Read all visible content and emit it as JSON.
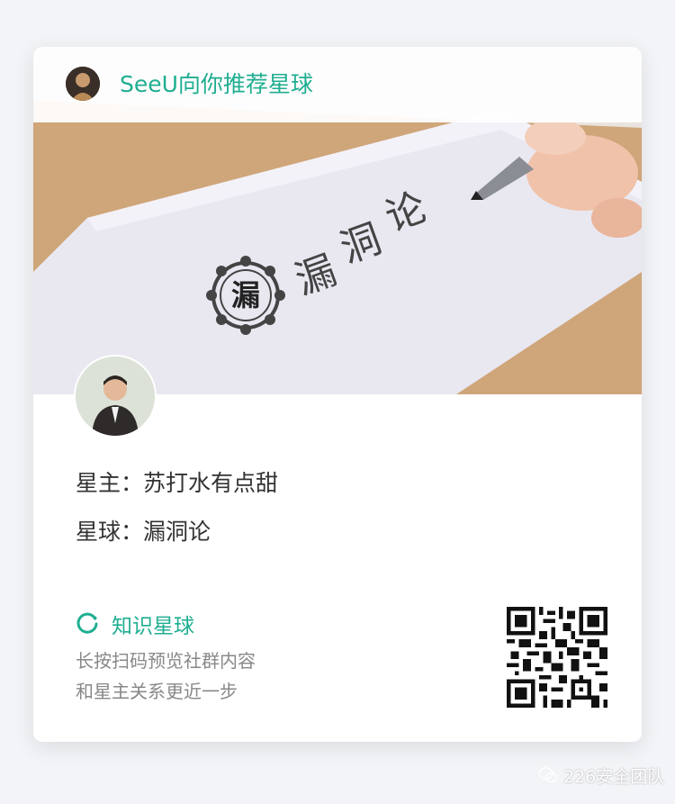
{
  "header": {
    "title": "SeeU向你推荐星球"
  },
  "hero": {
    "paper_text": [
      "漏",
      "洞",
      "论"
    ],
    "seal_char": "漏"
  },
  "owner": {
    "label": "星主：",
    "name": "苏打水有点甜"
  },
  "planet": {
    "label": "星球：",
    "name": "漏洞论"
  },
  "brand": {
    "name": "知识星球",
    "accent": "#1fae91"
  },
  "hint": {
    "line1": "长按扫码预览社群内容",
    "line2": "和星主关系更近一步"
  },
  "watermark": {
    "text": "226安全团队"
  }
}
